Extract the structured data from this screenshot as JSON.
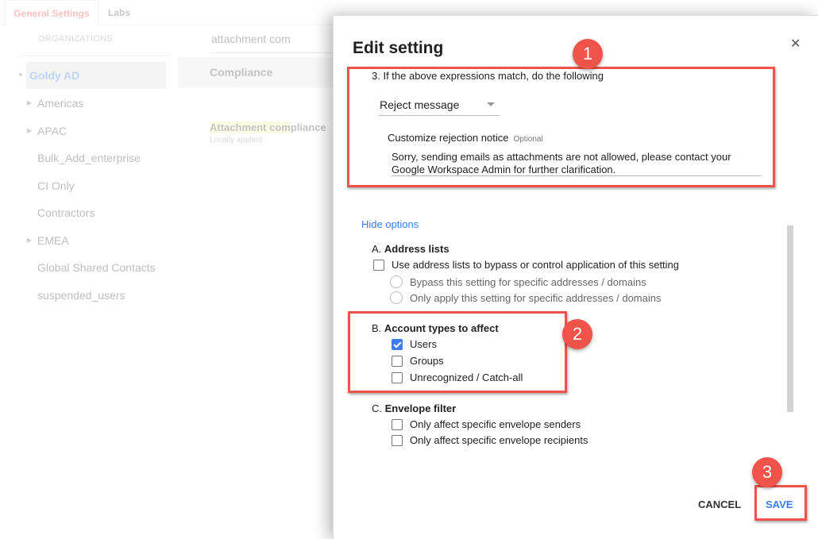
{
  "background": {
    "tabs": [
      {
        "label": "General Settings",
        "active": true
      },
      {
        "label": "Labs",
        "active": false
      }
    ],
    "organizations_header": "ORGANIZATIONS",
    "selected_org": "Goldy AD",
    "org_items": [
      {
        "label": "Americas",
        "expandable": true
      },
      {
        "label": "APAC",
        "expandable": true
      },
      {
        "label": "Bulk_Add_enterprise",
        "expandable": false
      },
      {
        "label": "CI Only",
        "expandable": false
      },
      {
        "label": "Contractors",
        "expandable": false
      },
      {
        "label": "EMEA",
        "expandable": true
      },
      {
        "label": "Global Shared Contacts",
        "expandable": false
      },
      {
        "label": "suspended_users",
        "expandable": false
      }
    ],
    "search_value": "attachment com",
    "section_title": "Compliance",
    "setting_name_highlight": "Attachment com",
    "setting_name_rest": "pliance",
    "setting_status": "Locally applied"
  },
  "dialog": {
    "title": "Edit setting",
    "close_icon": "close-icon",
    "step3_label": "3. If the above expressions match, do the following",
    "action_select": {
      "value": "Reject message"
    },
    "rejection_notice": {
      "label": "Customize rejection notice",
      "optional_label": "Optional",
      "value_line1": "Sorry, sending emails as attachments are not allowed, please contact your",
      "value_line2": "Google Workspace Admin for further clarification."
    },
    "hide_options_link": "Hide options",
    "section_a": {
      "prefix": "A.",
      "title": "Address lists",
      "checkbox": {
        "label": "Use address lists to bypass or control application of this setting",
        "checked": false
      },
      "radios": [
        {
          "label": "Bypass this setting for specific addresses / domains",
          "selected": false
        },
        {
          "label": "Only apply this setting for specific addresses / domains",
          "selected": false
        }
      ]
    },
    "section_b": {
      "prefix": "B.",
      "title": "Account types to affect",
      "checkboxes": [
        {
          "label": "Users",
          "checked": true
        },
        {
          "label": "Groups",
          "checked": false
        },
        {
          "label": "Unrecognized / Catch-all",
          "checked": false
        }
      ]
    },
    "section_c": {
      "prefix": "C.",
      "title": "Envelope filter",
      "checkboxes": [
        {
          "label": "Only affect specific envelope senders",
          "checked": false
        },
        {
          "label": "Only affect specific envelope recipients",
          "checked": false
        }
      ]
    },
    "buttons": {
      "cancel": "CANCEL",
      "save": "SAVE"
    }
  },
  "annotations": {
    "badge_1": "1",
    "badge_2": "2",
    "badge_3": "3",
    "highlight_color": "#f0534a"
  },
  "colors": {
    "accent_blue": "#3d7bf0",
    "tab_active": "#ea4335"
  }
}
